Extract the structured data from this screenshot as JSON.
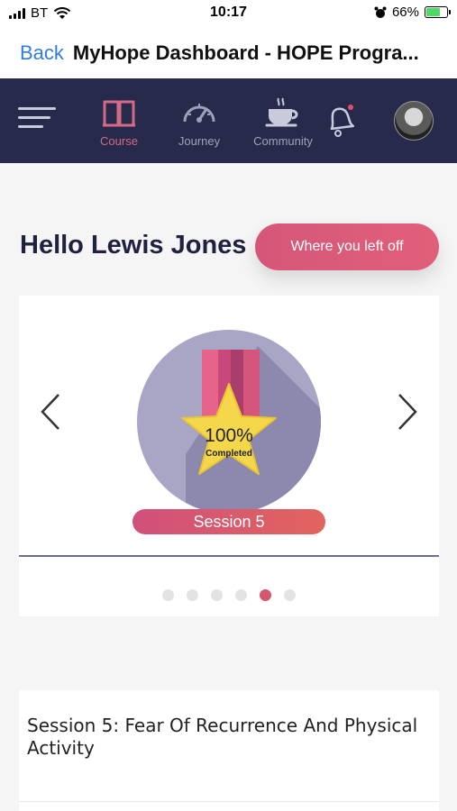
{
  "status_bar": {
    "carrier": "BT",
    "time": "10:17",
    "battery": "66%",
    "battery_level": 0.66
  },
  "title_bar": {
    "back_label": "Back",
    "title": "MyHope Dashboard - HOPE Progra..."
  },
  "app_header": {
    "nav": [
      {
        "label": "Course",
        "icon": "book-icon",
        "active": true
      },
      {
        "label": "Journey",
        "icon": "speedometer-icon",
        "active": false
      },
      {
        "label": "Community",
        "icon": "coffee-cup-icon",
        "active": false
      }
    ],
    "notification_icon": "bell-icon",
    "menu_icon": "hamburger-icon"
  },
  "main": {
    "greeting": "Hello Lewis Jones",
    "resume_button": "Where you left off"
  },
  "carousel": {
    "badge": {
      "percent": "100%",
      "caption": "Completed"
    },
    "session_label": "Session 5",
    "dots_total": 6,
    "active_index": 4
  },
  "session_card": {
    "title": "Session 5: Fear Of Recurrence And Physical Activity"
  },
  "colors": {
    "header_bg": "#272a4b",
    "accent_pink": "#d6567a",
    "back_blue": "#2f7de1"
  }
}
